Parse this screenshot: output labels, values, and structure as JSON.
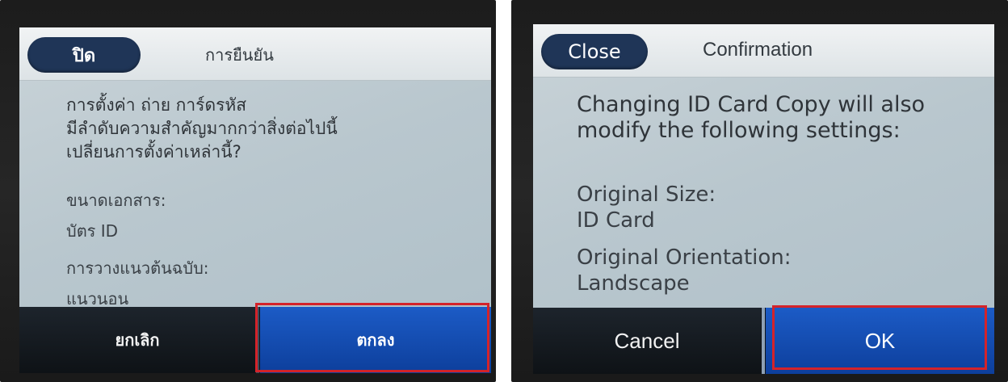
{
  "panels": {
    "thai": {
      "close_label": "ปิด",
      "title": "การยืนยัน",
      "message": "การตั้งค่า ถ่าย การ์ดรหัส\nมีลำดับความสำคัญมากกว่าสิ่งต่อไปนี้\nเปลี่ยนการตั้งค่าเหล่านี้?",
      "settings": [
        {
          "label": "ขนาดเอกสาร:",
          "value": "บัตร ID"
        },
        {
          "label": "การวางแนวต้นฉบับ:",
          "value": "แนวนอน"
        }
      ],
      "cancel_label": "ยกเลิก",
      "ok_label": "ตกลง"
    },
    "english": {
      "close_label": "Close",
      "title": "Confirmation",
      "message": "Changing ID Card Copy will also\nmodify the following settings:",
      "settings": [
        {
          "label": "Original Size:",
          "value": "ID Card"
        },
        {
          "label": "Original Orientation:",
          "value": "Landscape"
        }
      ],
      "cancel_label": "Cancel",
      "ok_label": "OK"
    }
  },
  "colors": {
    "highlight": "#d4232a",
    "ok_button": "#1c5bc6",
    "close_button": "#1f3557",
    "screen_background": "#bcc9cf"
  }
}
